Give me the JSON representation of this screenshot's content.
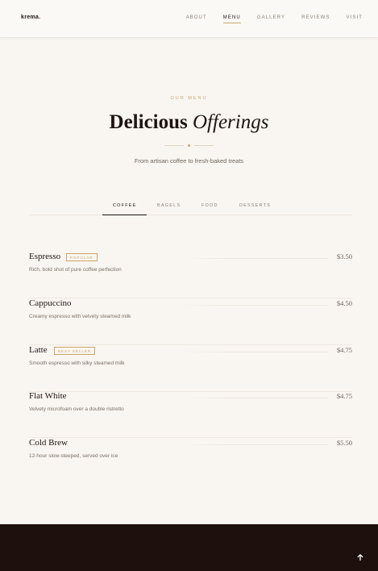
{
  "nav": {
    "logo": "krema.",
    "links": [
      {
        "label": "ABOUT",
        "active": false
      },
      {
        "label": "MENU",
        "active": true
      },
      {
        "label": "GALLERY",
        "active": false
      },
      {
        "label": "REVIEWS",
        "active": false
      },
      {
        "label": "VISIT",
        "active": false
      }
    ]
  },
  "section": {
    "eyebrow": "OUR MENU",
    "title_main": "Delicious",
    "title_accent": "Offerings",
    "subtitle": "From artisan coffee to fresh-baked treats"
  },
  "tabs": [
    {
      "label": "COFFEE",
      "active": true
    },
    {
      "label": "BAGELS",
      "active": false
    },
    {
      "label": "FOOD",
      "active": false
    },
    {
      "label": "DESSERTS",
      "active": false
    }
  ],
  "items": [
    {
      "name": "Espresso",
      "badge": "POPULAR",
      "price": "$3.50",
      "desc": "Rich, bold shot of pure coffee perfection"
    },
    {
      "name": "Cappuccino",
      "badge": "",
      "price": "$4.50",
      "desc": "Creamy espresso with velvety steamed milk"
    },
    {
      "name": "Latte",
      "badge": "BEST SELLER",
      "price": "$4.75",
      "desc": "Smooth espresso with silky steamed milk"
    },
    {
      "name": "Flat White",
      "badge": "",
      "price": "$4.75",
      "desc": "Velvety microfoam over a double ristretto"
    },
    {
      "name": "Cold Brew",
      "badge": "",
      "price": "$5.50",
      "desc": "12-hour slow-steeped, served over ice"
    }
  ],
  "icons": {
    "scroll_top": "arrow-up-icon"
  },
  "colors": {
    "accent": "#c9a66b",
    "dark": "#1e100c",
    "background": "#f9f6f1"
  }
}
